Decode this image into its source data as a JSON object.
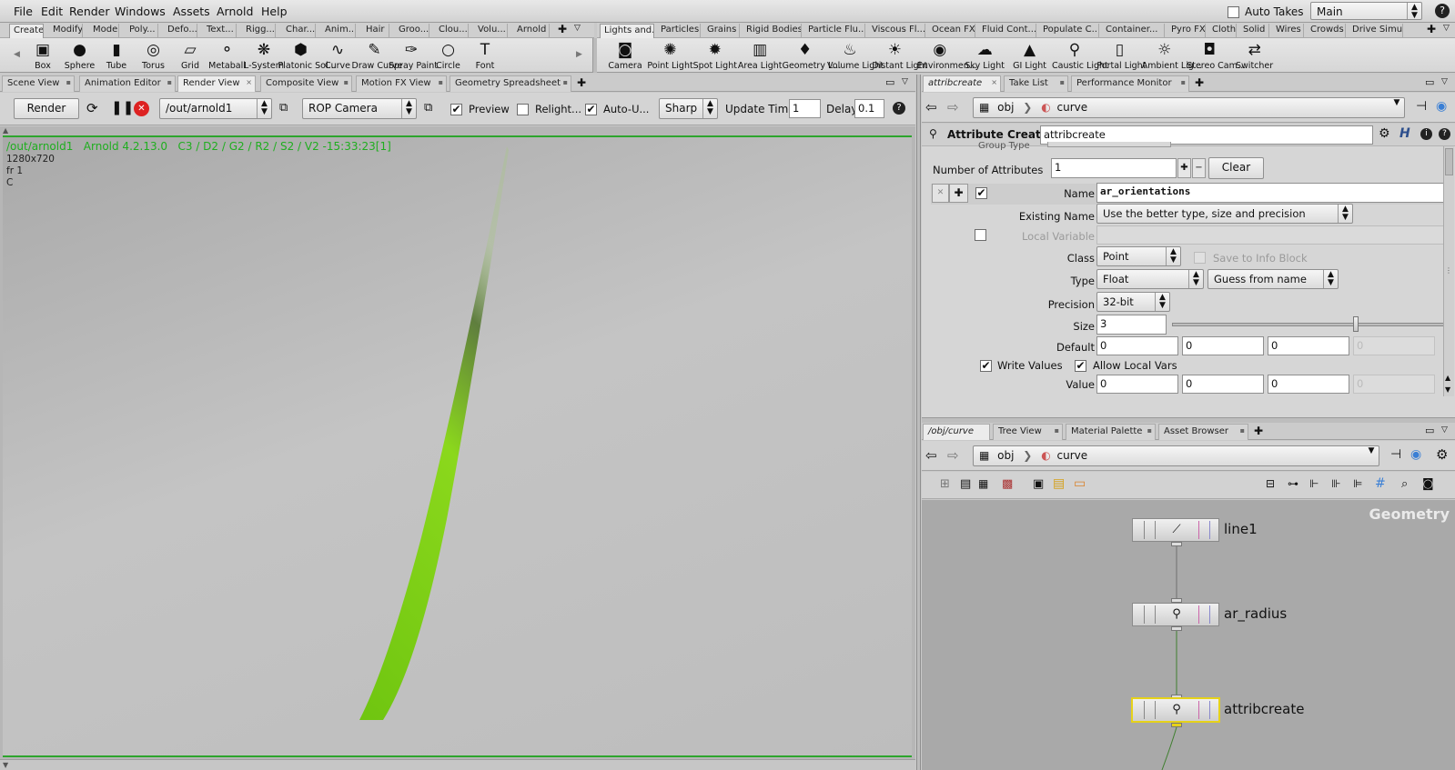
{
  "menubar": {
    "items": [
      "File",
      "Edit",
      "Render",
      "Windows",
      "Assets",
      "Arnold",
      "Help"
    ],
    "auto_takes_label": "Auto Takes",
    "desktop_value": "Main"
  },
  "shelf_left": {
    "tabs": [
      "Create",
      "Modify",
      "Model",
      "Poly...",
      "Defo...",
      "Text...",
      "Rigg...",
      "Char...",
      "Anim...",
      "Hair",
      "Groo...",
      "Clou...",
      "Volu...",
      "Arnold"
    ],
    "tools": [
      {
        "label": "Box",
        "icon": "box-icon",
        "glyph": "▣"
      },
      {
        "label": "Sphere",
        "icon": "sphere-icon",
        "glyph": "●"
      },
      {
        "label": "Tube",
        "icon": "tube-icon",
        "glyph": "▮"
      },
      {
        "label": "Torus",
        "icon": "torus-icon",
        "glyph": "◎"
      },
      {
        "label": "Grid",
        "icon": "grid-icon",
        "glyph": "▱"
      },
      {
        "label": "Metaball",
        "icon": "metaball-icon",
        "glyph": "⚬"
      },
      {
        "label": "L-System",
        "icon": "lsystem-icon",
        "glyph": "❋"
      },
      {
        "label": "Platonic Sol...",
        "icon": "platonic-icon",
        "glyph": "⬢"
      },
      {
        "label": "Curve",
        "icon": "curve-icon",
        "glyph": "∿"
      },
      {
        "label": "Draw Curve",
        "icon": "draw-curve-icon",
        "glyph": "✎"
      },
      {
        "label": "Spray Paint",
        "icon": "spray-paint-icon",
        "glyph": "✑"
      },
      {
        "label": "Circle",
        "icon": "circle-icon",
        "glyph": "○"
      },
      {
        "label": "Font",
        "icon": "font-icon",
        "glyph": "T"
      }
    ]
  },
  "shelf_right": {
    "tabs": [
      "Lights and...",
      "Particles",
      "Grains",
      "Rigid Bodies",
      "Particle Flu...",
      "Viscous Fl...",
      "Ocean FX",
      "Fluid Cont...",
      "Populate C...",
      "Container...",
      "Pyro FX",
      "Cloth",
      "Solid",
      "Wires",
      "Crowds",
      "Drive Simu..."
    ],
    "tools": [
      {
        "label": "Camera",
        "icon": "camera-icon",
        "glyph": "◙"
      },
      {
        "label": "Point Light",
        "icon": "point-light-icon",
        "glyph": "✺"
      },
      {
        "label": "Spot Light",
        "icon": "spot-light-icon",
        "glyph": "✹"
      },
      {
        "label": "Area Light",
        "icon": "area-light-icon",
        "glyph": "▥"
      },
      {
        "label": "Geometry L...",
        "icon": "geometry-light-icon",
        "glyph": "♦"
      },
      {
        "label": "Volume Light",
        "icon": "volume-light-icon",
        "glyph": "♨"
      },
      {
        "label": "Distant Light",
        "icon": "distant-light-icon",
        "glyph": "☀"
      },
      {
        "label": "Environmen...",
        "icon": "environment-light-icon",
        "glyph": "◉"
      },
      {
        "label": "Sky Light",
        "icon": "sky-light-icon",
        "glyph": "☁"
      },
      {
        "label": "GI Light",
        "icon": "gi-light-icon",
        "glyph": "▲"
      },
      {
        "label": "Caustic Light",
        "icon": "caustic-light-icon",
        "glyph": "⚲"
      },
      {
        "label": "Portal Light",
        "icon": "portal-light-icon",
        "glyph": "▯"
      },
      {
        "label": "Ambient Lig...",
        "icon": "ambient-light-icon",
        "glyph": "☼"
      },
      {
        "label": "Stereo Cam...",
        "icon": "stereo-camera-icon",
        "glyph": "◘"
      },
      {
        "label": "Switcher",
        "icon": "switcher-icon",
        "glyph": "⇄"
      }
    ]
  },
  "left_pane": {
    "tabs": [
      "Scene View",
      "Animation Editor",
      "Render View",
      "Composite View",
      "Motion FX View",
      "Geometry Spreadsheet"
    ],
    "active_tab": 2,
    "toolbar": {
      "render_label": "Render",
      "rop_path": "/out/arnold1",
      "camera": "ROP Camera",
      "preview_label": "Preview",
      "preview_checked": true,
      "relight_label": "Relight...",
      "relight_checked": false,
      "auto_update_label": "Auto-U...",
      "auto_update_checked": true,
      "sharp_label": "Sharp",
      "update_time_label": "Update Time",
      "update_time_value": "1",
      "delay_label": "Delay",
      "delay_value": "0.1"
    },
    "overlay": {
      "line1": "/out/arnold1   Arnold 4.2.13.0   C3 / D2 / G2 / R2 / S2 / V2 -15:33:23[1]",
      "resolution": "1280x720",
      "frame": "fr 1",
      "channel": "C"
    }
  },
  "parm_pane": {
    "tabs": [
      "attribcreate",
      "Take List",
      "Performance Monitor"
    ],
    "path": {
      "root": "obj",
      "node": "curve"
    },
    "node_type": "Attribute Create",
    "node_name": "attribcreate",
    "group_type_label": "Group Type",
    "num_attrs_label": "Number of Attributes",
    "num_attrs_value": "1",
    "clear_label": "Clear",
    "name_label": "Name",
    "name_value": "ar_orientations",
    "existing_label": "Existing Name",
    "existing_value": "Use the better type, size and precision",
    "local_var_label": "Local Variable",
    "class_label": "Class",
    "class_value": "Point",
    "save_info_label": "Save to Info Block",
    "type_label": "Type",
    "type_value": "Float",
    "guess_value": "Guess from name",
    "precision_label": "Precision",
    "precision_value": "32-bit",
    "size_label": "Size",
    "size_value": "3",
    "size_slider_fraction": 0.67,
    "default_label": "Default",
    "default_values": [
      "0",
      "0",
      "0",
      "0"
    ],
    "write_values_label": "Write Values",
    "allow_local_label": "Allow Local Vars",
    "value_label": "Value",
    "value_values": [
      "0",
      "0",
      "0",
      "0"
    ]
  },
  "network_pane": {
    "tabs": [
      "/obj/curve",
      "Tree View",
      "Material Palette",
      "Asset Browser"
    ],
    "path": {
      "root": "obj",
      "node": "curve"
    },
    "context_label": "Geometry",
    "nodes": [
      "line1",
      "ar_radius",
      "attribcreate"
    ],
    "selected_node": "attribcreate"
  },
  "colors": {
    "overlay_text": "#1fae1f",
    "selected_node": "#e6d21a",
    "grass": "#7fd11a"
  }
}
